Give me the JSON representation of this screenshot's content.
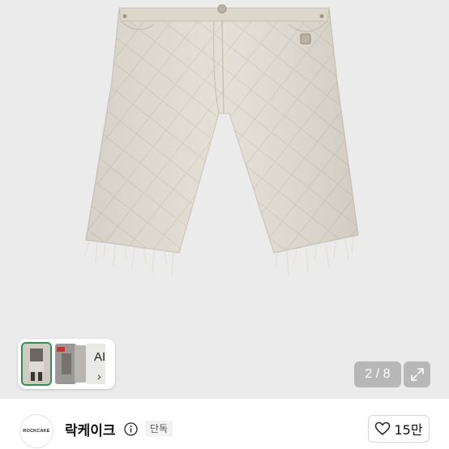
{
  "product": {
    "image_alt": "quilted beige denim shorts with frayed hem"
  },
  "gallery": {
    "ai_label": "AI",
    "ai_chevron": "›",
    "counter_current": 2,
    "counter_total": 8,
    "counter_text": "2 / 8"
  },
  "seller": {
    "avatar_text": "ROCKCAKE",
    "name": "락케이크",
    "badge": "단독"
  },
  "like": {
    "count": "15만"
  },
  "colors": {
    "gallery_bg": "#ebebeb",
    "fabric": "#e2ddd3",
    "thumb_border": "#2f8f4f"
  },
  "icons": [
    "info-icon",
    "expand-icon",
    "heart-icon",
    "chevron-right-icon"
  ]
}
